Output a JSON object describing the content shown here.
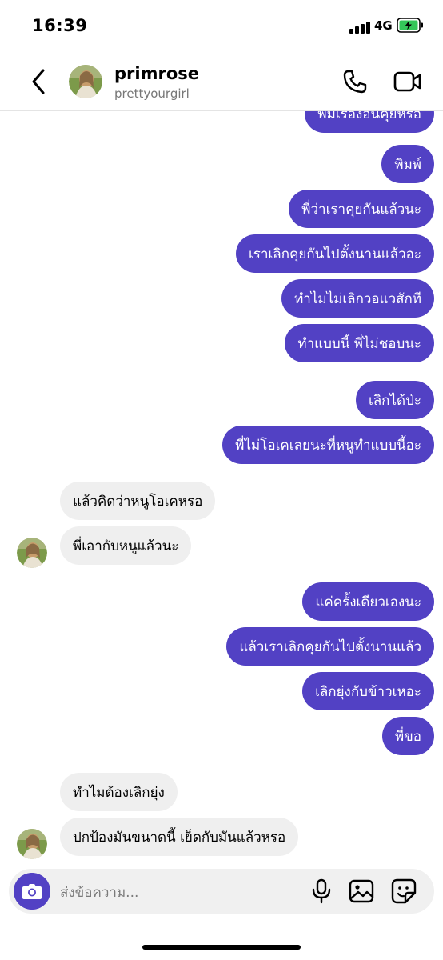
{
  "status_bar": {
    "time": "16:39",
    "network": "4G",
    "battery_color": "#34c759"
  },
  "header": {
    "name": "primrose",
    "username": "prettyourgirl",
    "back_icon": "chevron-left-icon",
    "call_icon": "phone-icon",
    "video_icon": "video-camera-icon"
  },
  "colors": {
    "outgoing_bubble": "#5241c4",
    "incoming_bubble": "#efefef"
  },
  "messages": [
    {
      "dir": "out",
      "text": "พิมเรื่องอื่นคุยหรือ"
    },
    {
      "dir": "out",
      "text": "พิมพ์"
    },
    {
      "dir": "out",
      "text": "พี่ว่าเราคุยกันแล้วนะ"
    },
    {
      "dir": "out",
      "text": "เราเลิกคุยกันไปตั้งนานแล้วอะ"
    },
    {
      "dir": "out",
      "text": "ทำไมไม่เลิกวอแวสักที"
    },
    {
      "dir": "out",
      "text": "ทำแบบนี้ พี่ไม่ชอบนะ"
    },
    {
      "dir": "out",
      "text": "เลิกได้ป่ะ"
    },
    {
      "dir": "out",
      "text": "พี่ไม่โอเคเลยนะที่หนูทำแบบนี้อะ"
    },
    {
      "dir": "in",
      "text": "แล้วคิดว่าหนูโอเคหรอ"
    },
    {
      "dir": "in",
      "text": "พี่เอากับหนูแล้วนะ"
    },
    {
      "dir": "out",
      "text": "แค่ครั้งเดียวเองนะ"
    },
    {
      "dir": "out",
      "text": "แล้วเราเลิกคุยกันไปตั้งนานแล้ว"
    },
    {
      "dir": "out",
      "text": "เลิกยุ่งกับข้าวเหอะ"
    },
    {
      "dir": "out",
      "text": "พี่ขอ"
    },
    {
      "dir": "in",
      "text": "ทำไมต้องเลิกยุ่ง"
    },
    {
      "dir": "in",
      "text": "ปกป้องมันขนาดนี้ เย็ดกับมันแล้วหรอ"
    }
  ],
  "composer": {
    "placeholder": "ส่งข้อความ...",
    "camera_icon": "camera-icon",
    "mic_icon": "microphone-icon",
    "gallery_icon": "image-icon",
    "sticker_icon": "sticker-icon"
  }
}
